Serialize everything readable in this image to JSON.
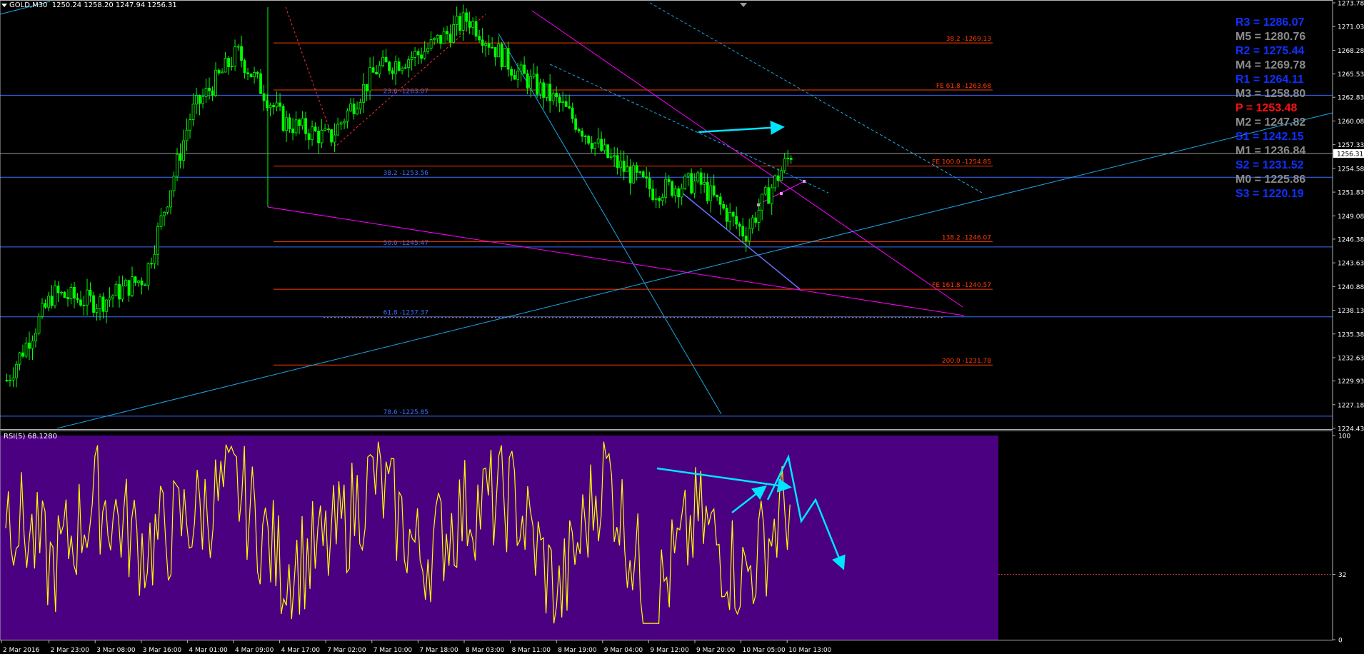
{
  "header": {
    "symbol": "GOLD,M30",
    "ohlc": "1250.24 1258.20 1247.94 1256.31"
  },
  "rsi_header": "RSI(5) 68.1280",
  "price_axis": {
    "ticks": [
      "1273.78",
      "1271.03",
      "1268.28",
      "1265.53",
      "1262.83",
      "1260.08",
      "1257.33",
      "1254.58",
      "1251.83",
      "1249.08",
      "1246.38",
      "1243.63",
      "1240.88",
      "1238.13",
      "1235.38",
      "1232.63",
      "1229.93",
      "1227.18",
      "1224.43"
    ],
    "current_price": "1256.31"
  },
  "rsi_axis": {
    "ticks": [
      "100",
      "32",
      "0"
    ]
  },
  "time_axis": [
    "2 Mar 2016",
    "2 Mar 23:00",
    "3 Mar 08:00",
    "3 Mar 16:00",
    "4 Mar 01:00",
    "4 Mar 09:00",
    "4 Mar 17:00",
    "7 Mar 02:00",
    "7 Mar 10:00",
    "7 Mar 18:00",
    "8 Mar 03:00",
    "8 Mar 11:00",
    "8 Mar 19:00",
    "9 Mar 04:00",
    "9 Mar 12:00",
    "9 Mar 20:00",
    "10 Mar 05:00",
    "10 Mar 13:00"
  ],
  "fib_blue": [
    {
      "label": "23.6 -1263.07",
      "price": 1263.07
    },
    {
      "label": "38.2 -1253.56",
      "price": 1253.56
    },
    {
      "label": "50.0 -1245.47",
      "price": 1245.47
    },
    {
      "label": "61.8 -1237.37",
      "price": 1237.37
    },
    {
      "label": "78.6 -1225.85",
      "price": 1225.85
    }
  ],
  "fib_red": [
    {
      "label": "38.2 -1269.13",
      "price": 1269.13
    },
    {
      "label": "FE 61.8 -1263.68",
      "price": 1263.68
    },
    {
      "label": "FE 100.0 -1254.85",
      "price": 1254.85
    },
    {
      "label": "138.2 -1246.07",
      "price": 1246.07
    },
    {
      "label": "FE 161.8 -1240.57",
      "price": 1240.57
    },
    {
      "label": "200.0 -1231.78",
      "price": 1231.78
    }
  ],
  "pivots": [
    {
      "label": "R3 = 1286.07",
      "color": "#1030ff"
    },
    {
      "label": "M5 = 1280.76",
      "color": "#8a8a8a"
    },
    {
      "label": "R2 = 1275.44",
      "color": "#1030ff"
    },
    {
      "label": "M4 = 1269.78",
      "color": "#8a8a8a"
    },
    {
      "label": "R1 = 1264.11",
      "color": "#1030ff"
    },
    {
      "label": "M3 = 1258.80",
      "color": "#8a8a8a"
    },
    {
      "label": "P   = 1253.48",
      "color": "#ff1010"
    },
    {
      "label": "M2 = 1247.82",
      "color": "#8a8a8a"
    },
    {
      "label": "S1 = 1242.15",
      "color": "#1030ff"
    },
    {
      "label": "M1 = 1236.84",
      "color": "#8a8a8a"
    },
    {
      "label": "S2 = 1231.52",
      "color": "#1030ff"
    },
    {
      "label": "M0 = 1225.86",
      "color": "#8a8a8a"
    },
    {
      "label": "S3 = 1220.19",
      "color": "#1030ff"
    }
  ],
  "colors": {
    "candle": "#00ff00",
    "rsi_line": "#ffff00",
    "rsi_bg": "#4b0082",
    "fib_blue": "#3c6cff",
    "fib_red": "#ff3c00",
    "magenta": "#ff00ff",
    "cyan": "#00e5ff",
    "trend": "#1ea7e8",
    "grid_text": "#ffffff"
  },
  "chart_data": {
    "type": "candlestick",
    "symbol": "GOLD",
    "timeframe": "M30",
    "ylim": [
      1224.43,
      1273.78
    ],
    "last": {
      "open": 1250.24,
      "high": 1258.2,
      "low": 1247.94,
      "close": 1256.31
    },
    "price_path": [
      [
        "2 Mar 2016",
        1230
      ],
      [
        "2 Mar 23:00",
        1240
      ],
      [
        "3 Mar 08:00",
        1239
      ],
      [
        "3 Mar 16:00",
        1242
      ],
      [
        "4 Mar 01:00",
        1261
      ],
      [
        "4 Mar 09:00",
        1268
      ],
      [
        "4 Mar 17:00",
        1260
      ],
      [
        "7 Mar 02:00",
        1258
      ],
      [
        "7 Mar 10:00",
        1266
      ],
      [
        "7 Mar 18:00",
        1268
      ],
      [
        "8 Mar 03:00",
        1272
      ],
      [
        "8 Mar 11:00",
        1266
      ],
      [
        "8 Mar 19:00",
        1262
      ],
      [
        "9 Mar 04:00",
        1256
      ],
      [
        "9 Mar 12:00",
        1252
      ],
      [
        "9 Mar 20:00",
        1253
      ],
      [
        "10 Mar 05:00",
        1247
      ],
      [
        "10 Mar 13:00",
        1256.31
      ]
    ],
    "indicator": {
      "name": "RSI(5)",
      "value": 68.128,
      "ylim": [
        0,
        100
      ],
      "level": 32,
      "path": [
        [
          "2 Mar 2016",
          68
        ],
        [
          "2 Mar 23:00",
          35
        ],
        [
          "3 Mar 08:00",
          70
        ],
        [
          "3 Mar 16:00",
          45
        ],
        [
          "4 Mar 01:00",
          60
        ],
        [
          "4 Mar 09:00",
          75
        ],
        [
          "4 Mar 17:00",
          35
        ],
        [
          "7 Mar 02:00",
          45
        ],
        [
          "7 Mar 10:00",
          80
        ],
        [
          "7 Mar 18:00",
          40
        ],
        [
          "8 Mar 03:00",
          65
        ],
        [
          "8 Mar 11:00",
          70
        ],
        [
          "8 Mar 19:00",
          20
        ],
        [
          "9 Mar 04:00",
          85
        ],
        [
          "9 Mar 12:00",
          15
        ],
        [
          "9 Mar 20:00",
          60
        ],
        [
          "10 Mar 05:00",
          30
        ],
        [
          "10 Mar 13:00",
          68
        ]
      ]
    }
  }
}
